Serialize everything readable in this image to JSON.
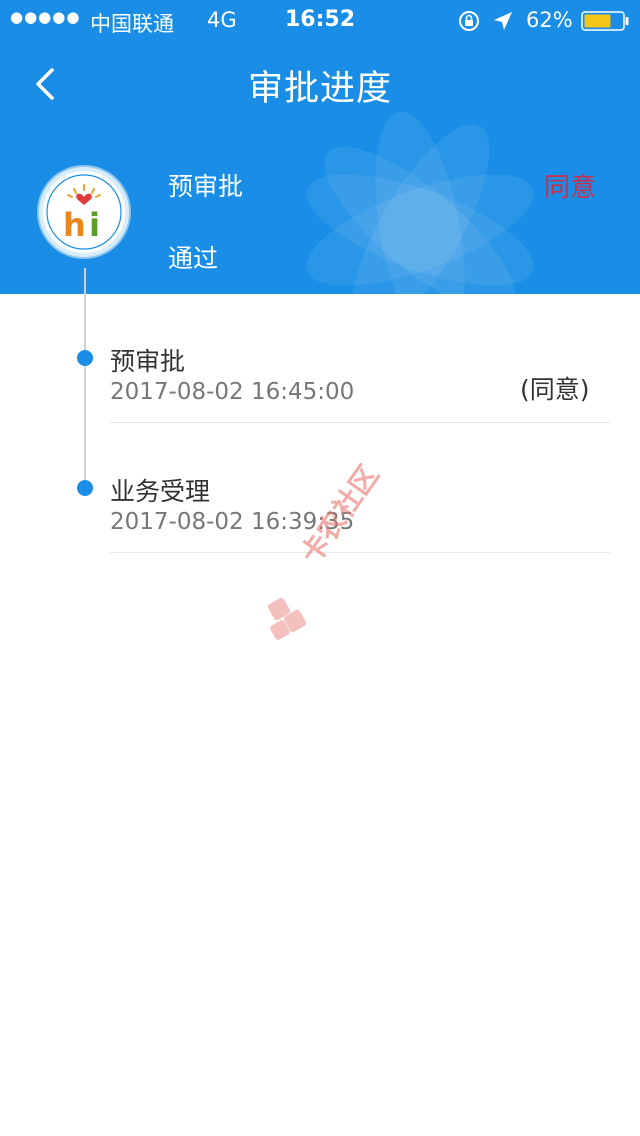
{
  "status_bar": {
    "signal_dots": "●●●●●",
    "carrier": "中国联通",
    "network": "4G",
    "time": "16:52",
    "battery_percent": "62%",
    "icons": [
      "rotation-lock-icon",
      "location-arrow-icon",
      "battery-icon"
    ]
  },
  "nav": {
    "back_icon": "chevron-left-icon",
    "title": "审批进度"
  },
  "header": {
    "avatar_logo_text": "hi",
    "stage": "预审批",
    "status": "通过",
    "result": "同意",
    "result_color": "#c9304a"
  },
  "timeline": [
    {
      "stage": "预审批",
      "time": "2017-08-02 16:45:00",
      "result": "(同意)"
    },
    {
      "stage": "业务受理",
      "time": "2017-08-02 16:39:35"
    }
  ],
  "watermark_text": "卡农社区",
  "colors": {
    "primary": "#1a8ee6",
    "accent_red": "#c9304a"
  }
}
